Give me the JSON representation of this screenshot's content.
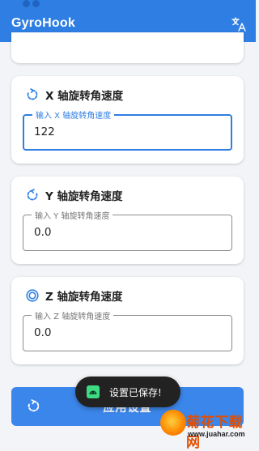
{
  "app": {
    "title": "GyroHook"
  },
  "header_icons": [
    "translate-icon"
  ],
  "cards": {
    "x": {
      "label": "X 轴旋转角速度",
      "placeholder": "输入 X 轴旋转角速度",
      "value": "122",
      "icon": "rotate-clockwise-icon"
    },
    "y": {
      "label": "Y 轴旋转角速度",
      "placeholder": "输入 Y 轴旋转角速度",
      "value": "0.0",
      "icon": "rotate-counterclockwise-icon"
    },
    "z": {
      "label": "Z 轴旋转角速度",
      "placeholder": "输入 Z 轴旋转角速度",
      "value": "0.0",
      "icon": "target-circle-icon"
    }
  },
  "apply_button": {
    "label": "应用设置",
    "icon": "rotate-icon"
  },
  "toast": {
    "text": "设置已保存!",
    "icon": "android-icon"
  },
  "watermark": {
    "brand": "菊花下载网",
    "url": "www.juahar.com"
  },
  "colors": {
    "primary": "#2f7ee3",
    "button": "#3b86ea",
    "toast": "#222222",
    "background": "#f2f4f7"
  }
}
